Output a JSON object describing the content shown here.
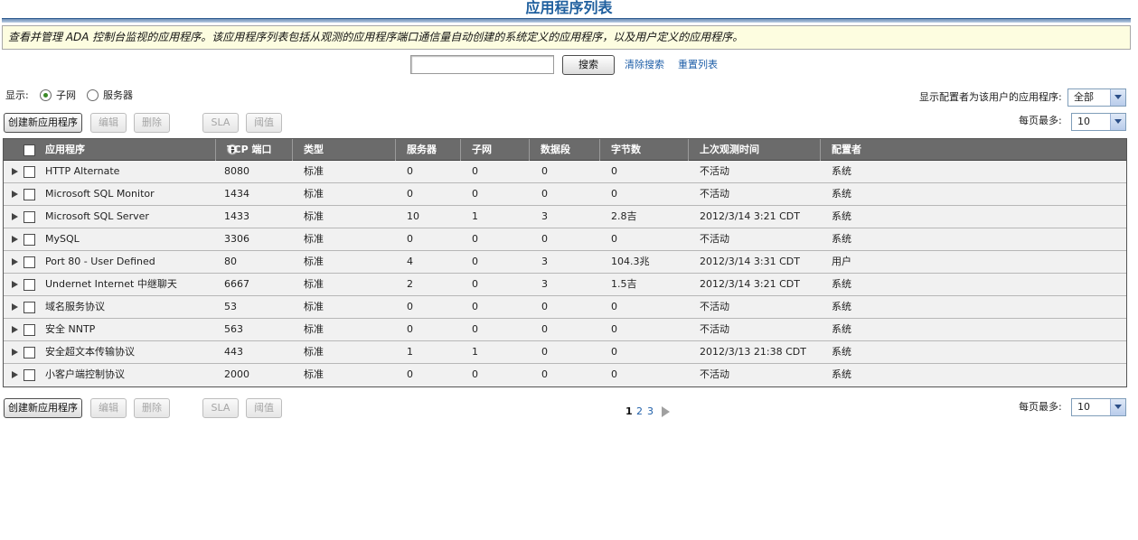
{
  "page_title": "应用程序列表",
  "description": "查看并管理 ADA 控制台监视的应用程序。该应用程序列表包括从观测的应用程序端口通信量自动创建的系统定义的应用程序，以及用户定义的应用程序。",
  "search": {
    "value": "",
    "button_label": "搜索",
    "clear_label": "清除搜索",
    "reset_label": "重置列表"
  },
  "show": {
    "label": "显示:",
    "options": [
      "子网",
      "服务器"
    ],
    "selected": "子网"
  },
  "filter": {
    "label": "显示配置者为该用户的应用程序:",
    "value": "全部"
  },
  "per_page": {
    "label": "每页最多:",
    "value": "10"
  },
  "toolbar": {
    "create_label": "创建新应用程序",
    "edit_label": "编辑",
    "delete_label": "删除",
    "sla_label": "SLA",
    "threshold_label": "阈值"
  },
  "table": {
    "columns": [
      "应用程序",
      "TCP 端口",
      "类型",
      "服务器",
      "子网",
      "数据段",
      "字节数",
      "上次观测时间",
      "配置者"
    ],
    "rows": [
      [
        "HTTP Alternate",
        "8080",
        "标准",
        "0",
        "0",
        "0",
        "0",
        "不活动",
        "系统"
      ],
      [
        "Microsoft SQL Monitor",
        "1434",
        "标准",
        "0",
        "0",
        "0",
        "0",
        "不活动",
        "系统"
      ],
      [
        "Microsoft SQL Server",
        "1433",
        "标准",
        "10",
        "1",
        "3",
        "2.8吉",
        "2012/3/14 3:21 CDT",
        "系统"
      ],
      [
        "MySQL",
        "3306",
        "标准",
        "0",
        "0",
        "0",
        "0",
        "不活动",
        "系统"
      ],
      [
        "Port 80 - User Defined",
        "80",
        "标准",
        "4",
        "0",
        "3",
        "104.3兆",
        "2012/3/14 3:31 CDT",
        "用户"
      ],
      [
        "Undernet Internet 中继聊天",
        "6667",
        "标准",
        "2",
        "0",
        "3",
        "1.5吉",
        "2012/3/14 3:21 CDT",
        "系统"
      ],
      [
        "域名服务协议",
        "53",
        "标准",
        "0",
        "0",
        "0",
        "0",
        "不活动",
        "系统"
      ],
      [
        "安全 NNTP",
        "563",
        "标准",
        "0",
        "0",
        "0",
        "0",
        "不活动",
        "系统"
      ],
      [
        "安全超文本传输协议",
        "443",
        "标准",
        "1",
        "1",
        "0",
        "0",
        "2012/3/13 21:38 CDT",
        "系统"
      ],
      [
        "小客户端控制协议",
        "2000",
        "标准",
        "0",
        "0",
        "0",
        "0",
        "不活动",
        "系统"
      ]
    ]
  },
  "pagination": {
    "pages": [
      "1",
      "2",
      "3"
    ],
    "current": "1"
  },
  "colors": {
    "title": "#1f5f9e",
    "header_bg": "#6b6b6b",
    "row_bg": "#f1f1f1",
    "description_bg": "#fdfde0",
    "link": "#1f5fa8",
    "radio_selected": "#3b8a27"
  },
  "icons": {
    "sort": "sort-arrows-icon",
    "expand": "triangle-right-icon",
    "next": "triangle-right-icon",
    "dropdown": "chevron-down-icon"
  }
}
